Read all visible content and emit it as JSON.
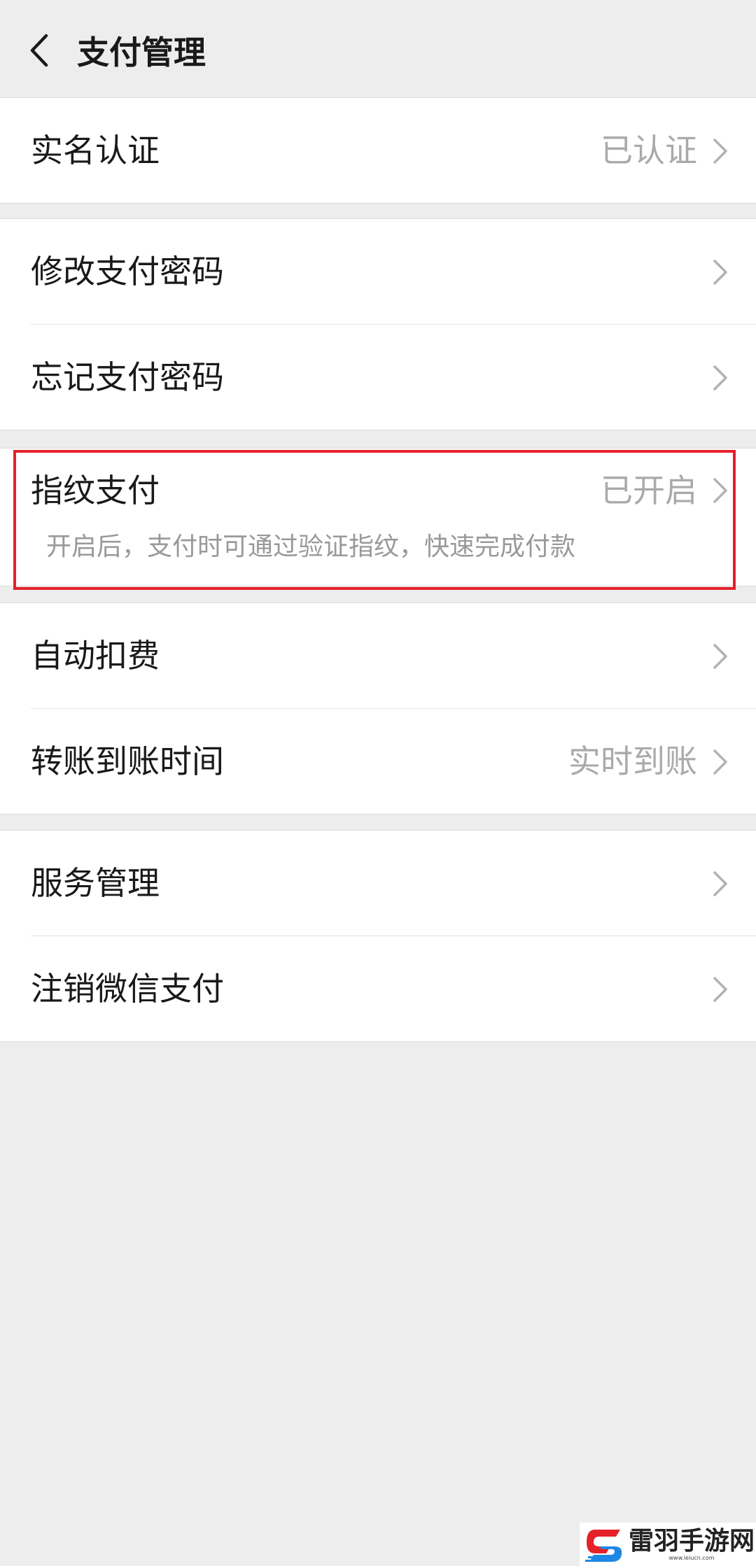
{
  "header": {
    "title": "支付管理",
    "back_icon": "chevron-left-icon"
  },
  "groups": {
    "identity": {
      "realname": {
        "label": "实名认证",
        "value": "已认证"
      }
    },
    "password": {
      "change": {
        "label": "修改支付密码"
      },
      "forgot": {
        "label": "忘记支付密码"
      }
    },
    "fingerprint": {
      "label": "指纹支付",
      "value": "已开启",
      "description": "开启后，支付时可通过验证指纹，快速完成付款"
    },
    "payment": {
      "auto_deduct": {
        "label": "自动扣费"
      },
      "transfer_time": {
        "label": "转账到账时间",
        "value": "实时到账"
      }
    },
    "service": {
      "manage": {
        "label": "服务管理"
      },
      "cancel": {
        "label": "注销微信支付"
      }
    }
  },
  "watermark": {
    "text": "雷羽手游网",
    "url": "www.leiucn.com"
  },
  "colors": {
    "highlight": "#e5212a",
    "background": "#ededed",
    "secondary_text": "#aaaaaa"
  }
}
